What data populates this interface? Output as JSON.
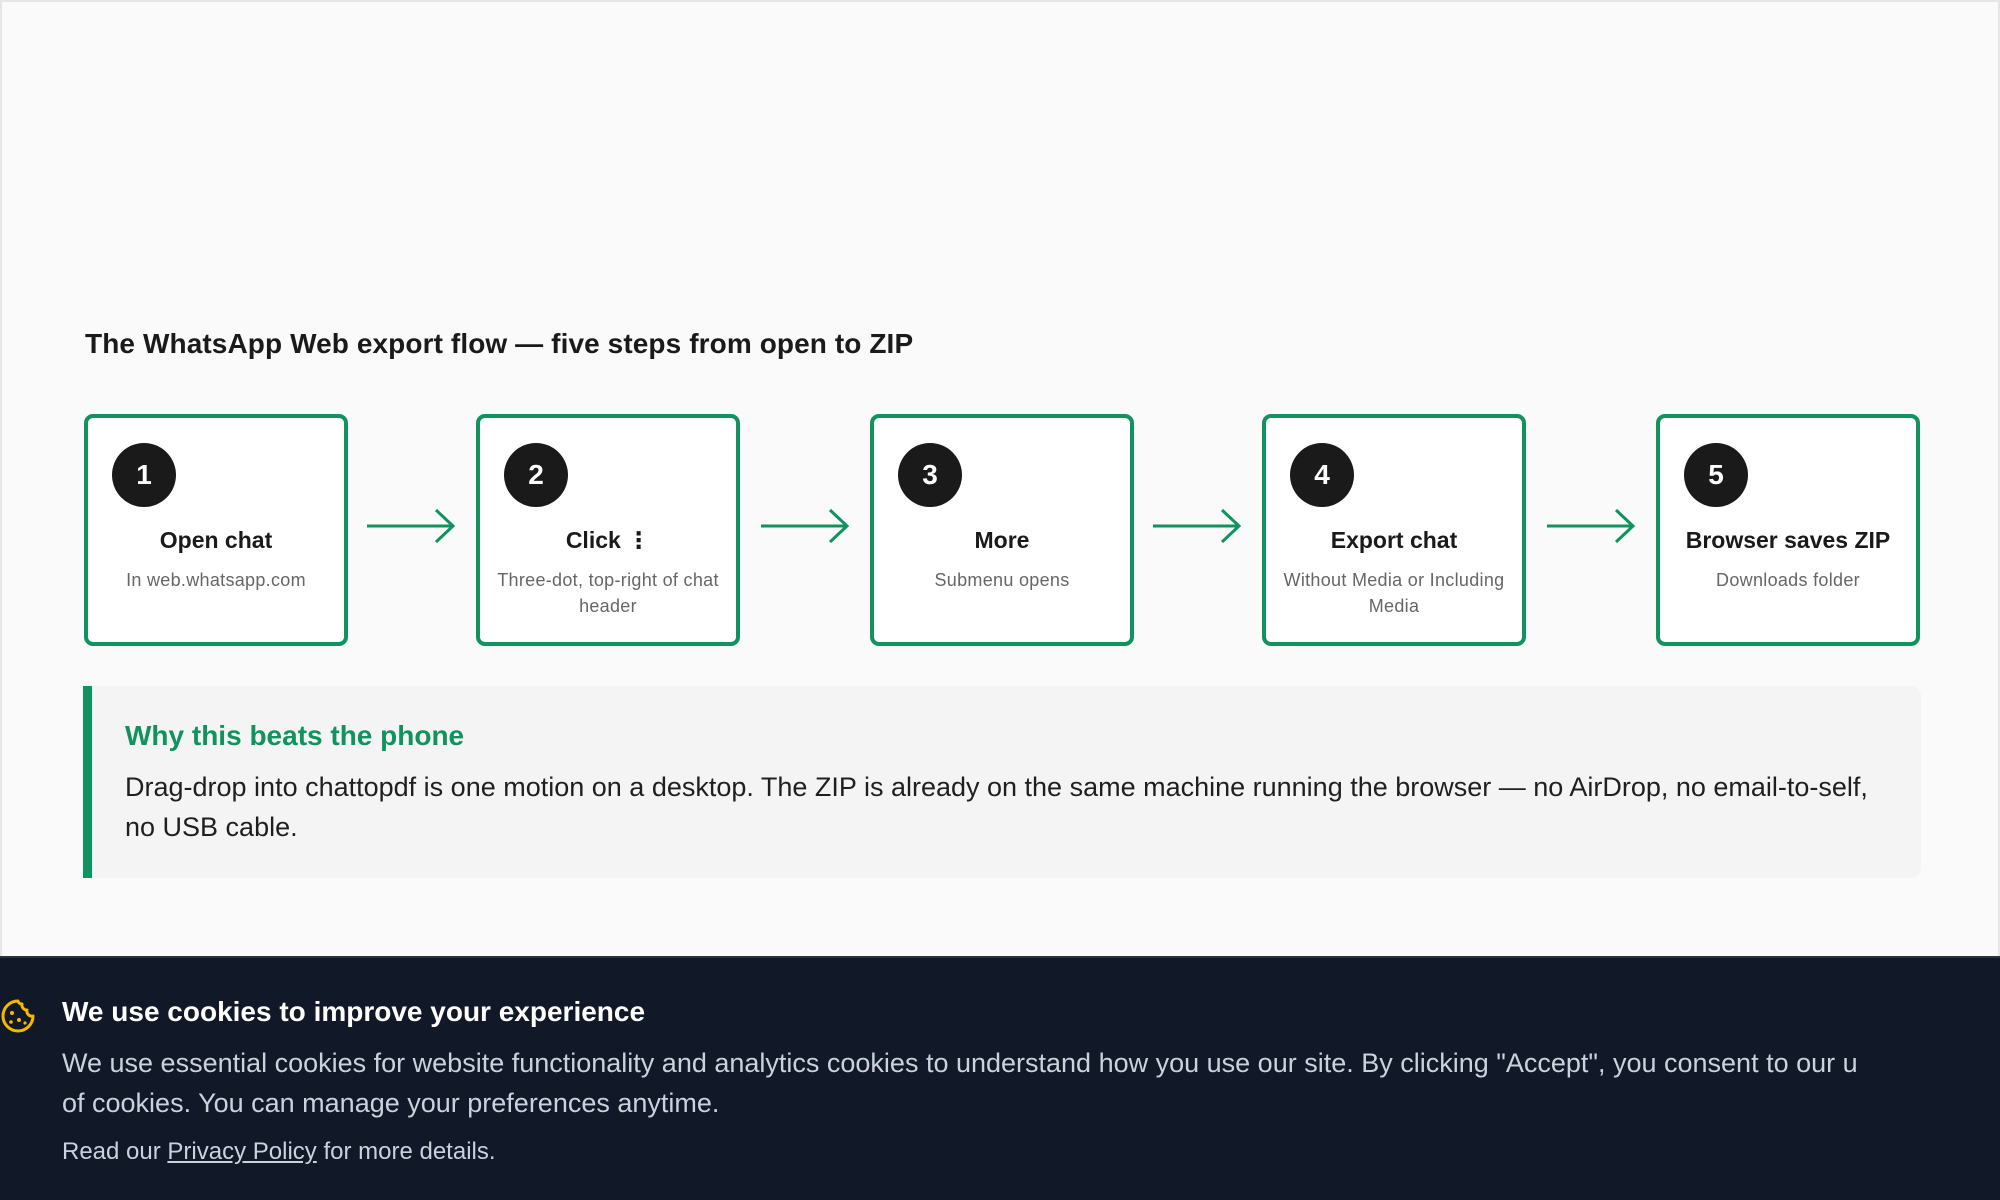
{
  "flow": {
    "title": "The WhatsApp Web export flow — five steps from open to ZIP",
    "steps": [
      {
        "number": "1",
        "title": "Open chat",
        "subtitle": "In web.whatsapp.com"
      },
      {
        "number": "2",
        "title": "Click ⋮",
        "subtitle": "Three-dot, top-right of chat header"
      },
      {
        "number": "3",
        "title": "More",
        "subtitle": "Submenu opens"
      },
      {
        "number": "4",
        "title": "Export chat",
        "subtitle": "Without Media or Including Media"
      },
      {
        "number": "5",
        "title": "Browser saves ZIP",
        "subtitle": "Downloads folder"
      }
    ]
  },
  "callout": {
    "title": "Why this beats the phone",
    "body": "Drag-drop into chattopdf is one motion on a desktop. The ZIP is already on the same machine running the browser — no AirDrop, no email-to-self, no USB cable."
  },
  "cookie_banner": {
    "title": "We use cookies to improve your experience",
    "body_line1": "We use essential cookies for website functionality and analytics cookies to understand how you use our site. By clicking \"Accept\", you consent to our u",
    "body_line2": "of cookies. You can manage your preferences anytime.",
    "policy_prefix": "Read our",
    "policy_link": "Privacy Policy",
    "policy_suffix": "for more details."
  },
  "colors": {
    "accent": "#10935e",
    "banner_bg": "#111827",
    "cookie_icon": "#f5b800"
  },
  "icons": {
    "arrow": "arrow-right-icon",
    "cookie": "cookie-icon"
  }
}
